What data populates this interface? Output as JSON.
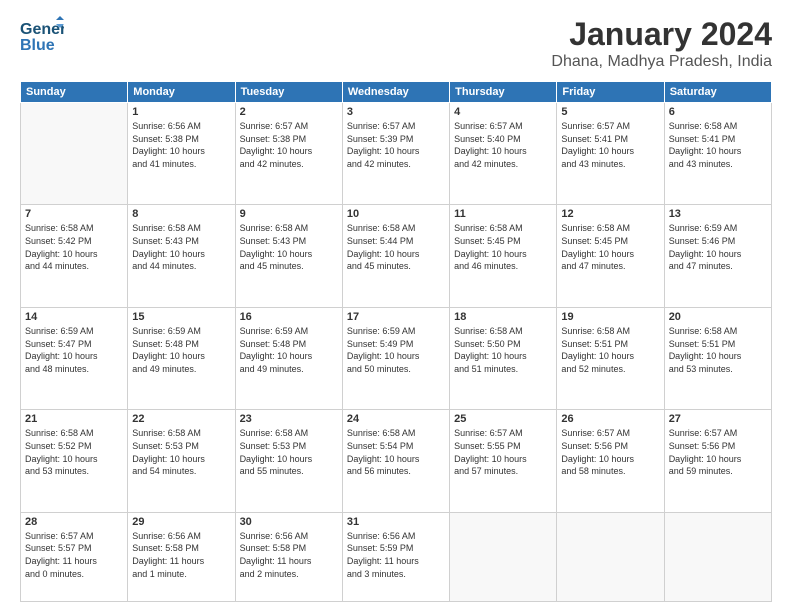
{
  "header": {
    "logo_text1": "General",
    "logo_text2": "Blue",
    "month": "January 2024",
    "location": "Dhana, Madhya Pradesh, India"
  },
  "days_of_week": [
    "Sunday",
    "Monday",
    "Tuesday",
    "Wednesday",
    "Thursday",
    "Friday",
    "Saturday"
  ],
  "weeks": [
    [
      {
        "day": "",
        "info": ""
      },
      {
        "day": "1",
        "info": "Sunrise: 6:56 AM\nSunset: 5:38 PM\nDaylight: 10 hours\nand 41 minutes."
      },
      {
        "day": "2",
        "info": "Sunrise: 6:57 AM\nSunset: 5:38 PM\nDaylight: 10 hours\nand 42 minutes."
      },
      {
        "day": "3",
        "info": "Sunrise: 6:57 AM\nSunset: 5:39 PM\nDaylight: 10 hours\nand 42 minutes."
      },
      {
        "day": "4",
        "info": "Sunrise: 6:57 AM\nSunset: 5:40 PM\nDaylight: 10 hours\nand 42 minutes."
      },
      {
        "day": "5",
        "info": "Sunrise: 6:57 AM\nSunset: 5:41 PM\nDaylight: 10 hours\nand 43 minutes."
      },
      {
        "day": "6",
        "info": "Sunrise: 6:58 AM\nSunset: 5:41 PM\nDaylight: 10 hours\nand 43 minutes."
      }
    ],
    [
      {
        "day": "7",
        "info": "Sunrise: 6:58 AM\nSunset: 5:42 PM\nDaylight: 10 hours\nand 44 minutes."
      },
      {
        "day": "8",
        "info": "Sunrise: 6:58 AM\nSunset: 5:43 PM\nDaylight: 10 hours\nand 44 minutes."
      },
      {
        "day": "9",
        "info": "Sunrise: 6:58 AM\nSunset: 5:43 PM\nDaylight: 10 hours\nand 45 minutes."
      },
      {
        "day": "10",
        "info": "Sunrise: 6:58 AM\nSunset: 5:44 PM\nDaylight: 10 hours\nand 45 minutes."
      },
      {
        "day": "11",
        "info": "Sunrise: 6:58 AM\nSunset: 5:45 PM\nDaylight: 10 hours\nand 46 minutes."
      },
      {
        "day": "12",
        "info": "Sunrise: 6:58 AM\nSunset: 5:45 PM\nDaylight: 10 hours\nand 47 minutes."
      },
      {
        "day": "13",
        "info": "Sunrise: 6:59 AM\nSunset: 5:46 PM\nDaylight: 10 hours\nand 47 minutes."
      }
    ],
    [
      {
        "day": "14",
        "info": "Sunrise: 6:59 AM\nSunset: 5:47 PM\nDaylight: 10 hours\nand 48 minutes."
      },
      {
        "day": "15",
        "info": "Sunrise: 6:59 AM\nSunset: 5:48 PM\nDaylight: 10 hours\nand 49 minutes."
      },
      {
        "day": "16",
        "info": "Sunrise: 6:59 AM\nSunset: 5:48 PM\nDaylight: 10 hours\nand 49 minutes."
      },
      {
        "day": "17",
        "info": "Sunrise: 6:59 AM\nSunset: 5:49 PM\nDaylight: 10 hours\nand 50 minutes."
      },
      {
        "day": "18",
        "info": "Sunrise: 6:58 AM\nSunset: 5:50 PM\nDaylight: 10 hours\nand 51 minutes."
      },
      {
        "day": "19",
        "info": "Sunrise: 6:58 AM\nSunset: 5:51 PM\nDaylight: 10 hours\nand 52 minutes."
      },
      {
        "day": "20",
        "info": "Sunrise: 6:58 AM\nSunset: 5:51 PM\nDaylight: 10 hours\nand 53 minutes."
      }
    ],
    [
      {
        "day": "21",
        "info": "Sunrise: 6:58 AM\nSunset: 5:52 PM\nDaylight: 10 hours\nand 53 minutes."
      },
      {
        "day": "22",
        "info": "Sunrise: 6:58 AM\nSunset: 5:53 PM\nDaylight: 10 hours\nand 54 minutes."
      },
      {
        "day": "23",
        "info": "Sunrise: 6:58 AM\nSunset: 5:53 PM\nDaylight: 10 hours\nand 55 minutes."
      },
      {
        "day": "24",
        "info": "Sunrise: 6:58 AM\nSunset: 5:54 PM\nDaylight: 10 hours\nand 56 minutes."
      },
      {
        "day": "25",
        "info": "Sunrise: 6:57 AM\nSunset: 5:55 PM\nDaylight: 10 hours\nand 57 minutes."
      },
      {
        "day": "26",
        "info": "Sunrise: 6:57 AM\nSunset: 5:56 PM\nDaylight: 10 hours\nand 58 minutes."
      },
      {
        "day": "27",
        "info": "Sunrise: 6:57 AM\nSunset: 5:56 PM\nDaylight: 10 hours\nand 59 minutes."
      }
    ],
    [
      {
        "day": "28",
        "info": "Sunrise: 6:57 AM\nSunset: 5:57 PM\nDaylight: 11 hours\nand 0 minutes."
      },
      {
        "day": "29",
        "info": "Sunrise: 6:56 AM\nSunset: 5:58 PM\nDaylight: 11 hours\nand 1 minute."
      },
      {
        "day": "30",
        "info": "Sunrise: 6:56 AM\nSunset: 5:58 PM\nDaylight: 11 hours\nand 2 minutes."
      },
      {
        "day": "31",
        "info": "Sunrise: 6:56 AM\nSunset: 5:59 PM\nDaylight: 11 hours\nand 3 minutes."
      },
      {
        "day": "",
        "info": ""
      },
      {
        "day": "",
        "info": ""
      },
      {
        "day": "",
        "info": ""
      }
    ]
  ]
}
